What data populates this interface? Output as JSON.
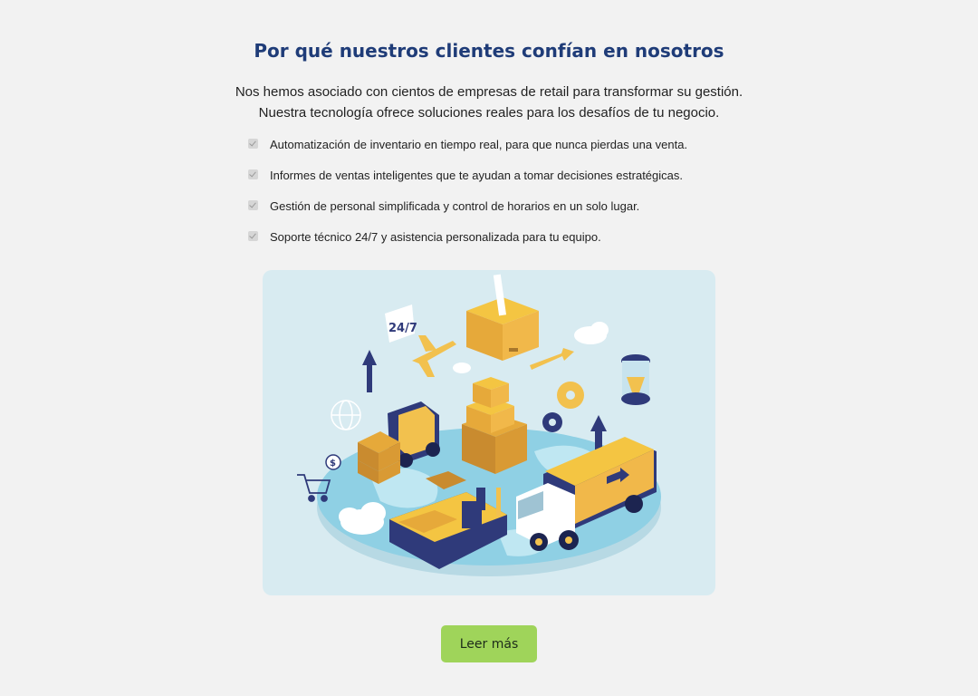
{
  "section": {
    "title": "Por qué nuestros clientes confían en nosotros",
    "intro": [
      "Nos hemos asociado con cientos de empresas de retail para transformar su gestión.",
      "Nuestra tecnología ofrece soluciones reales para los desafíos de tu negocio."
    ],
    "features": [
      "Automatización de inventario en tiempo real, para que nunca pierdas una venta.",
      "Informes de ventas inteligentes que te ayudan a tomar decisiones estratégicas.",
      "Gestión de personal simplificada y control de horarios en un solo lugar.",
      "Soporte técnico 24/7 y asistencia personalizada para tu equipo."
    ],
    "illustration": {
      "badge_text": "24/7",
      "coin_symbol": "$"
    },
    "cta_label": "Leer más"
  },
  "colors": {
    "title": "#1f3c78",
    "cta_background": "#9fd45a",
    "page_background": "#f2f2f2",
    "illustration_background": "#d8ebf1"
  }
}
